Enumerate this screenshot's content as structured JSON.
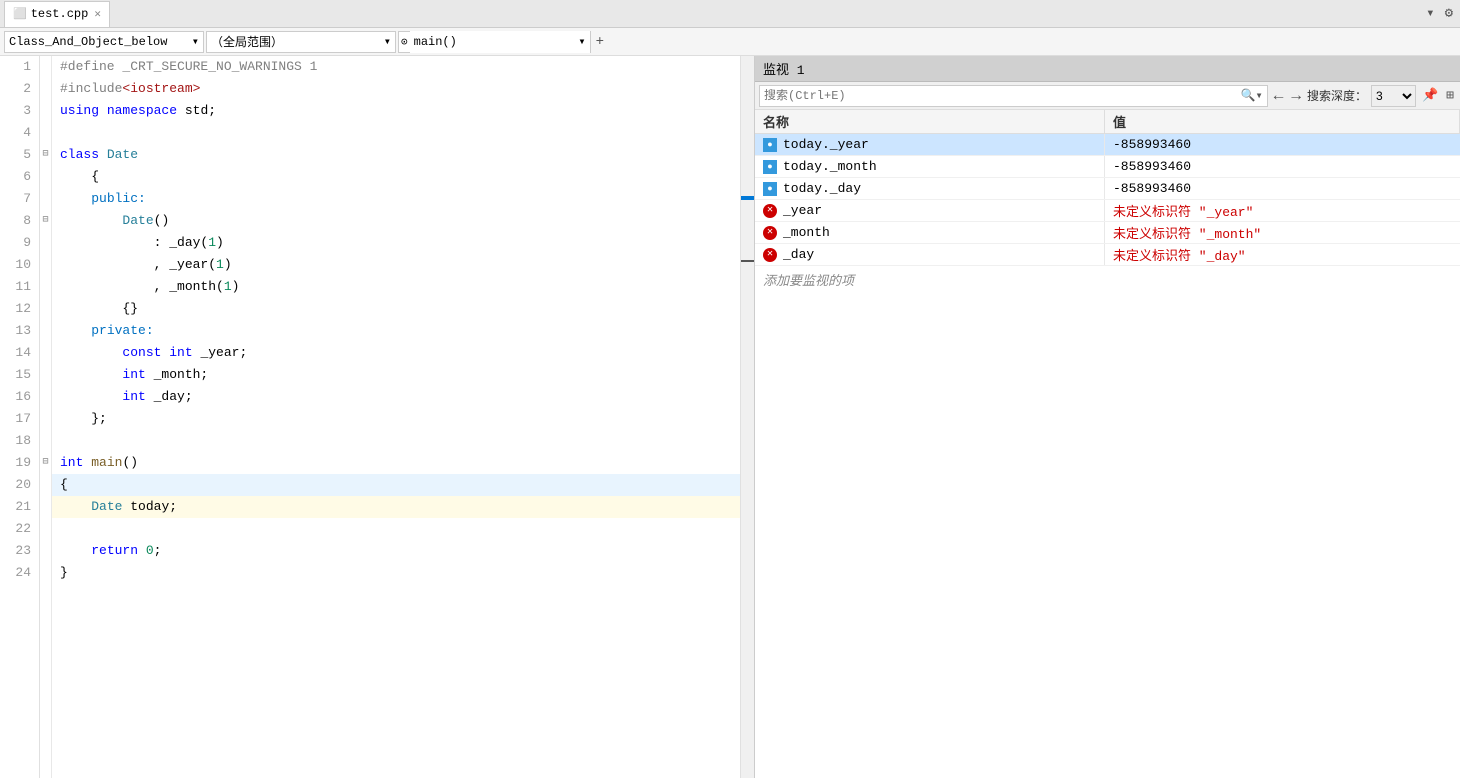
{
  "tab": {
    "filename": "test.cpp",
    "modified": false
  },
  "toolbar": {
    "class_scope": "Class_And_Object_below",
    "global_scope": "（全局范围）",
    "function_scope": "main()",
    "add_btn": "+"
  },
  "watch_panel": {
    "title": "监视 1",
    "search_placeholder": "搜索(Ctrl+E)",
    "search_depth_label": "搜索深度：",
    "depth_value": "3",
    "col_name": "名称",
    "col_value": "值",
    "rows": [
      {
        "id": 0,
        "icon": "var",
        "name": "today._year",
        "value": "-858993460",
        "selected": true
      },
      {
        "id": 1,
        "icon": "var",
        "name": "today._month",
        "value": "-858993460",
        "selected": false
      },
      {
        "id": 2,
        "icon": "var",
        "name": "today._day",
        "value": "-858993460",
        "selected": false
      },
      {
        "id": 3,
        "icon": "err",
        "name": "_year",
        "value": "未定义标识符 \"_year\"",
        "selected": false
      },
      {
        "id": 4,
        "icon": "err",
        "name": "_month",
        "value": "未定义标识符 \"_month\"",
        "selected": false
      },
      {
        "id": 5,
        "icon": "err",
        "name": "_day",
        "value": "未定义标识符 \"_day\"",
        "selected": false
      }
    ],
    "add_watch_label": "添加要监视的项"
  },
  "editor": {
    "lines": [
      {
        "num": 1,
        "indent": 0,
        "tokens": [
          {
            "t": "pp",
            "v": "#define _CRT_SECURE_NO_WARNINGS 1"
          }
        ]
      },
      {
        "num": 2,
        "indent": 0,
        "tokens": [
          {
            "t": "pp",
            "v": "#include"
          },
          {
            "t": "str",
            "v": "<iostream>"
          }
        ]
      },
      {
        "num": 3,
        "indent": 0,
        "tokens": [
          {
            "t": "kw",
            "v": "using"
          },
          {
            "t": "plain",
            "v": " "
          },
          {
            "t": "kw",
            "v": "namespace"
          },
          {
            "t": "plain",
            "v": " std;"
          }
        ]
      },
      {
        "num": 4,
        "indent": 0,
        "tokens": []
      },
      {
        "num": 5,
        "indent": 0,
        "fold": true,
        "tokens": [
          {
            "t": "kw",
            "v": "class"
          },
          {
            "t": "plain",
            "v": " "
          },
          {
            "t": "cls",
            "v": "Date"
          }
        ]
      },
      {
        "num": 6,
        "indent": 1,
        "tokens": [
          {
            "t": "plain",
            "v": "{"
          }
        ]
      },
      {
        "num": 7,
        "indent": 1,
        "tokens": [
          {
            "t": "acc",
            "v": "public:"
          }
        ]
      },
      {
        "num": 8,
        "indent": 2,
        "fold": true,
        "tokens": [
          {
            "t": "cls",
            "v": "Date"
          },
          {
            "t": "plain",
            "v": "()"
          }
        ]
      },
      {
        "num": 9,
        "indent": 3,
        "tokens": [
          {
            "t": "plain",
            "v": ": _day("
          },
          {
            "t": "num",
            "v": "1"
          },
          {
            "t": "plain",
            "v": ")"
          }
        ]
      },
      {
        "num": 10,
        "indent": 3,
        "tokens": [
          {
            "t": "plain",
            "v": ", _year("
          },
          {
            "t": "num",
            "v": "1"
          },
          {
            "t": "plain",
            "v": ")"
          }
        ]
      },
      {
        "num": 11,
        "indent": 3,
        "tokens": [
          {
            "t": "plain",
            "v": ", _month("
          },
          {
            "t": "num",
            "v": "1"
          },
          {
            "t": "plain",
            "v": ")"
          }
        ]
      },
      {
        "num": 12,
        "indent": 2,
        "tokens": [
          {
            "t": "plain",
            "v": "{}"
          }
        ]
      },
      {
        "num": 13,
        "indent": 1,
        "tokens": [
          {
            "t": "acc",
            "v": "private:"
          }
        ]
      },
      {
        "num": 14,
        "indent": 2,
        "tokens": [
          {
            "t": "kw",
            "v": "const"
          },
          {
            "t": "plain",
            "v": " "
          },
          {
            "t": "kw",
            "v": "int"
          },
          {
            "t": "plain",
            "v": " _year;"
          }
        ]
      },
      {
        "num": 15,
        "indent": 2,
        "tokens": [
          {
            "t": "kw",
            "v": "int"
          },
          {
            "t": "plain",
            "v": " _month;"
          }
        ]
      },
      {
        "num": 16,
        "indent": 2,
        "tokens": [
          {
            "t": "kw",
            "v": "int"
          },
          {
            "t": "plain",
            "v": " _day;"
          }
        ]
      },
      {
        "num": 17,
        "indent": 1,
        "tokens": [
          {
            "t": "plain",
            "v": "};"
          }
        ]
      },
      {
        "num": 18,
        "indent": 0,
        "tokens": []
      },
      {
        "num": 19,
        "indent": 0,
        "fold": true,
        "tokens": [
          {
            "t": "kw",
            "v": "int"
          },
          {
            "t": "plain",
            "v": " "
          },
          {
            "t": "fn",
            "v": "main"
          },
          {
            "t": "plain",
            "v": "()"
          }
        ]
      },
      {
        "num": 20,
        "indent": 0,
        "tokens": [
          {
            "t": "plain",
            "v": "{"
          }
        ]
      },
      {
        "num": 21,
        "indent": 1,
        "tokens": [
          {
            "t": "cls",
            "v": "Date"
          },
          {
            "t": "plain",
            "v": " today;"
          }
        ],
        "breakpoint": true,
        "current": true
      },
      {
        "num": 22,
        "indent": 0,
        "tokens": []
      },
      {
        "num": 23,
        "indent": 1,
        "tokens": [
          {
            "t": "kw",
            "v": "return"
          },
          {
            "t": "plain",
            "v": " "
          },
          {
            "t": "num",
            "v": "0"
          },
          {
            "t": "plain",
            "v": ";"
          }
        ]
      },
      {
        "num": 24,
        "indent": 0,
        "tokens": [
          {
            "t": "plain",
            "v": "}"
          }
        ]
      }
    ]
  }
}
